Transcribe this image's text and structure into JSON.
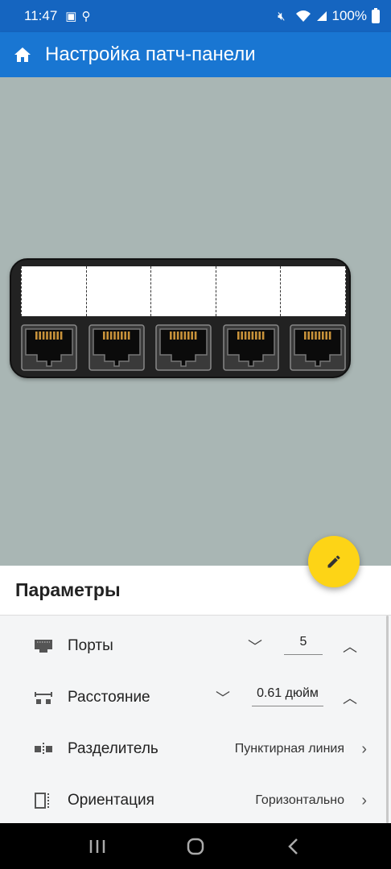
{
  "status": {
    "time": "11:47",
    "battery": "100%"
  },
  "app_bar": {
    "title": "Настройка патч-панели"
  },
  "panel": {
    "port_count": 5
  },
  "sheet": {
    "title": "Параметры",
    "ports": {
      "label": "Порты",
      "value": "5"
    },
    "spacing": {
      "label": "Расстояние",
      "value": "0.61 дюйм"
    },
    "separator": {
      "label": "Разделитель",
      "value": "Пунктирная линия"
    },
    "orientation": {
      "label": "Ориентация",
      "value": "Горизонтально"
    }
  },
  "colors": {
    "primary": "#1976d2",
    "status": "#1565c0",
    "accent": "#fdd416",
    "canvas": "#a9b6b4"
  },
  "icons": [
    "home-icon",
    "pencil-icon",
    "ethernet-icon",
    "spacing-icon",
    "separator-icon",
    "orientation-icon",
    "chevron-down-icon",
    "chevron-up-icon",
    "chevron-right-icon"
  ]
}
